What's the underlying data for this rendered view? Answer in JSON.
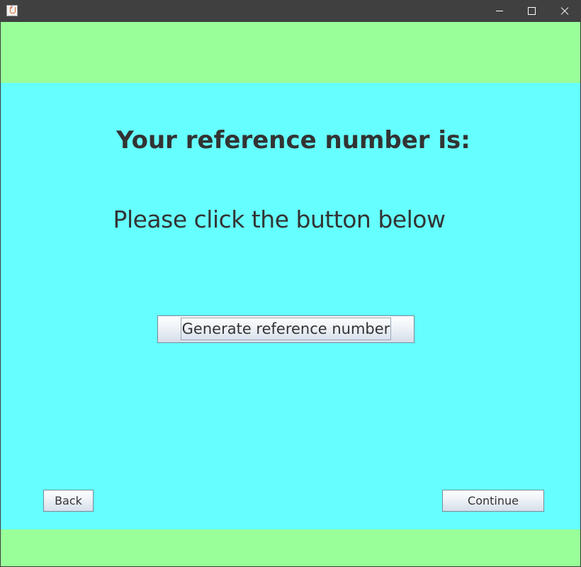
{
  "window": {
    "title": "",
    "controls": {
      "minimize": "minimize-icon",
      "maximize": "maximize-icon",
      "close": "close-icon"
    }
  },
  "colors": {
    "titlebar": "#404040",
    "band": "#99ff99",
    "panel": "#66ffff",
    "text": "#333333"
  },
  "main": {
    "heading": "Your reference number is:",
    "instruction": "Please click the button below",
    "generate_label": "Generate reference number"
  },
  "footer": {
    "back_label": "Back",
    "continue_label": "Continue"
  }
}
